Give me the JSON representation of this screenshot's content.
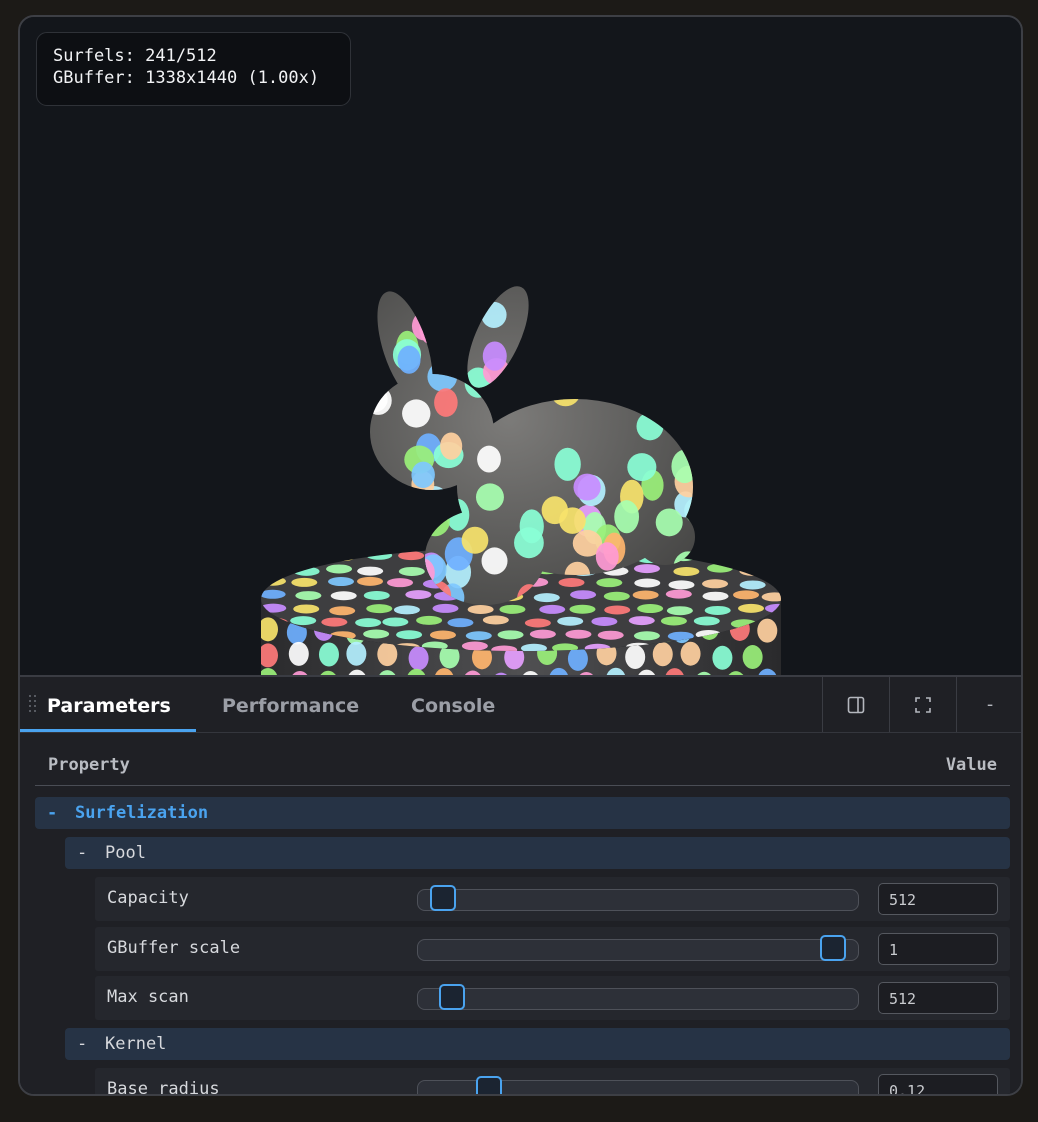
{
  "overlay": {
    "surfels_line": "Surfels: 241/512",
    "gbuffer_line": "GBuffer: 1338x1440 (1.00x)"
  },
  "tabs": [
    {
      "label": "Parameters",
      "active": true
    },
    {
      "label": "Performance",
      "active": false
    },
    {
      "label": "Console",
      "active": false
    }
  ],
  "toolbar": {
    "dock_icon": "dock-panel-icon",
    "fullscreen_icon": "fullscreen-icon",
    "minimize_label": "-"
  },
  "table": {
    "header_property": "Property",
    "header_value": "Value",
    "sections": {
      "surfelization": {
        "toggle": "-",
        "label": "Surfelization"
      },
      "pool": {
        "toggle": "-",
        "label": "Pool"
      },
      "kernel": {
        "toggle": "-",
        "label": "Kernel"
      }
    },
    "params": {
      "capacity": {
        "label": "Capacity",
        "value": "512",
        "level": 0.03
      },
      "gbuffer_scale": {
        "label": "GBuffer scale",
        "value": "1",
        "level": 0.97
      },
      "max_scan": {
        "label": "Max scan",
        "value": "512",
        "level": 0.05
      },
      "base_radius": {
        "label": "Base radius",
        "value": "0.12",
        "level": 0.14
      }
    }
  },
  "colors": {
    "accent": "#4aa3ef",
    "section_bg": "#263345",
    "panel_bg": "#1f2025",
    "viewport_bg": "#13161b"
  }
}
